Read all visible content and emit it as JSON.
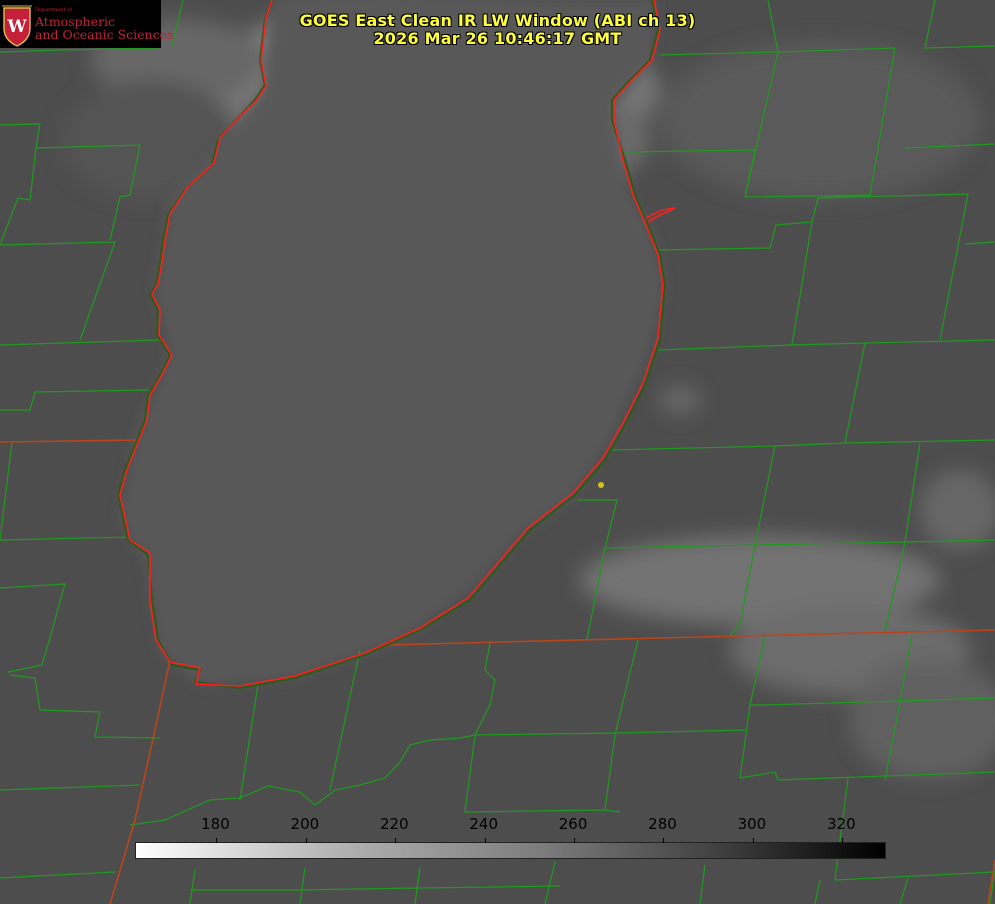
{
  "title": {
    "line1": "GOES East Clean IR LW Window (ABI ch 13)",
    "line2": "2026 Mar 26 10:46:17 GMT"
  },
  "logo": {
    "department": "Department of",
    "line1": "Atmospheric",
    "line2": "and Oceanic Sciences",
    "emblem": "W"
  },
  "colorbar": {
    "min": 162,
    "max": 330,
    "ticks": [
      "180",
      "200",
      "220",
      "240",
      "260",
      "280",
      "300",
      "320"
    ]
  },
  "colors": {
    "title": "#ffff3c",
    "county_lines": "#1f9a1f",
    "state_lines": "#b9451d",
    "coastline": "#ff1e1e",
    "marker": "#d6c21a",
    "logo_red": "#c5203a"
  }
}
